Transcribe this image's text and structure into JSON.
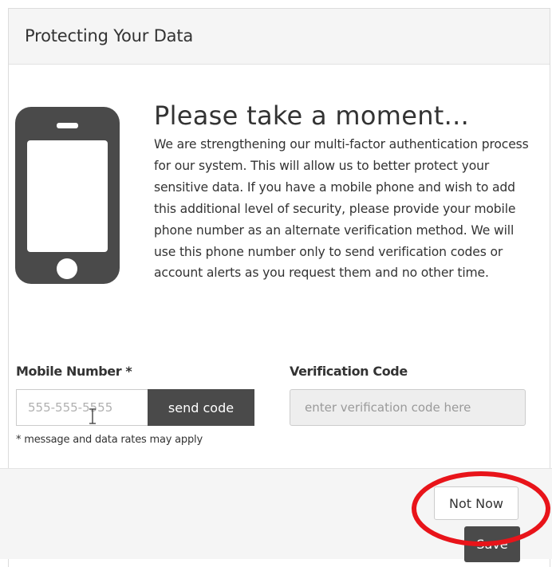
{
  "panel": {
    "title": "Protecting Your Data"
  },
  "content": {
    "heading": "Please take a moment...",
    "body": "We are strengthening our multi-factor authentication process for our system. This will allow us to better protect your sensitive data. If you have a mobile phone and wish to add this additional level of security, please provide your mobile phone number as an alternate verification method. We will use this phone number only to send verification codes or account alerts as you request them and no other time.",
    "icon": "mobile-phone-icon"
  },
  "form": {
    "mobile_label": "Mobile Number *",
    "mobile_placeholder": "555-555-5555",
    "mobile_value": "",
    "send_code_label": "send code",
    "verification_label": "Verification Code",
    "verification_placeholder": "enter verification code here",
    "verification_value": "",
    "note": "* message and data rates may apply"
  },
  "footer": {
    "not_now_label": "Not Now",
    "save_label": "Save"
  },
  "colors": {
    "header_bg": "#f5f5f5",
    "dark_button": "#4a4a4a",
    "icon": "#4a4a4a",
    "highlight": "#e8141a"
  }
}
